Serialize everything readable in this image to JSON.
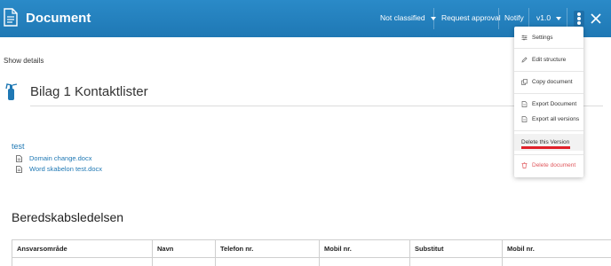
{
  "topbar": {
    "title": "Document",
    "classification": "Not classified",
    "request_approval": "Request approval",
    "notify": "Notify",
    "version": "v1.0",
    "colors": {
      "bar": "#1f78b4",
      "text": "#ffffff"
    }
  },
  "show_details": "Show details",
  "document": {
    "heading": "Bilag 1 Kontaktlister"
  },
  "attachments": {
    "title": "test",
    "files": [
      "Domain change.docx",
      "Word skabelon test.docx"
    ]
  },
  "section": {
    "title": "Beredskabsledelsen",
    "columns": [
      "Ansvarsområde",
      "Navn",
      "Telefon nr.",
      "Mobil nr.",
      "Substitut",
      "Mobil nr."
    ]
  },
  "menu": {
    "settings": "Settings",
    "edit_structure": "Edit structure",
    "copy_document": "Copy document",
    "export_document": "Export Document",
    "export_all_versions": "Export all versions",
    "delete_version": "Delete this Version",
    "delete_document": "Delete document",
    "colors": {
      "danger": "#e0565b",
      "underline": "#e0202a"
    }
  }
}
